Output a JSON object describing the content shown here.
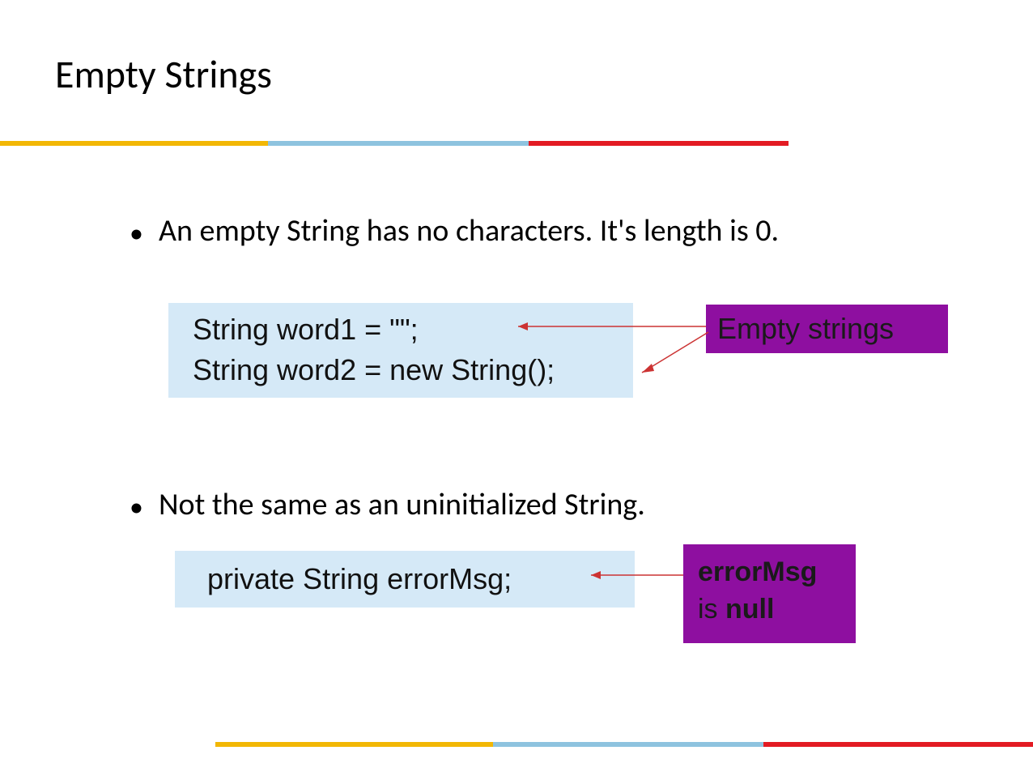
{
  "title": "Empty Strings",
  "bullets": {
    "b1": "An empty String has no characters.  It's length is 0.",
    "b2": "Not the same as an uninitialized String."
  },
  "code": {
    "c1_line1": "String word1 = \"\";",
    "c1_line2": "String word2 = new String();",
    "c2": "private String errorMsg;"
  },
  "callouts": {
    "empty_strings": "Empty strings",
    "errormsg_prefix": "errorMsg",
    "errormsg_between": "is ",
    "errormsg_null": "null"
  },
  "colors": {
    "yellow": "#f2b705",
    "blue": "#8ec3df",
    "red": "#e31b23",
    "lightblue": "#d5e9f7",
    "purple": "#8e0fa0",
    "arrow": "#cc3333"
  }
}
